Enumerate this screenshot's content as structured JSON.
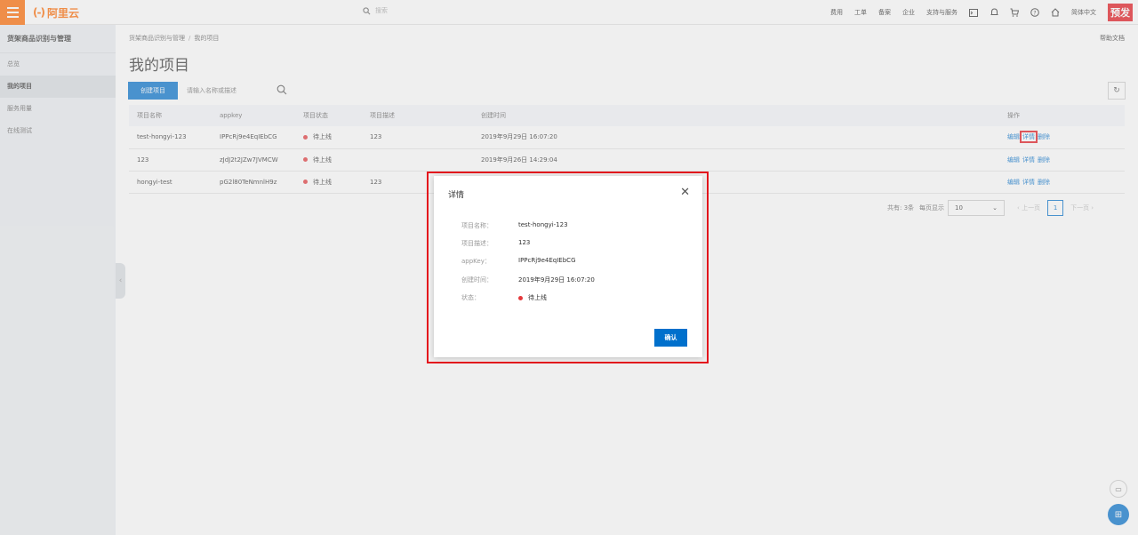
{
  "topbar": {
    "logo_text": "阿里云",
    "search_placeholder": "搜索",
    "links": [
      "费用",
      "工单",
      "备案",
      "企业",
      "支持与服务"
    ],
    "language": "简体中文",
    "preview_badge": "预发"
  },
  "sidebar": {
    "title": "货架商品识别与管理",
    "items": [
      {
        "label": "总览",
        "active": false
      },
      {
        "label": "我的项目",
        "active": true
      },
      {
        "label": "服务用量",
        "active": false
      },
      {
        "label": "在线测试",
        "active": false
      }
    ]
  },
  "main": {
    "breadcrumb_parent": "货架商品识别与管理",
    "breadcrumb_sep": "/",
    "breadcrumb_current": "我的项目",
    "help_doc": "帮助文档",
    "title": "我的项目",
    "create_button": "创建项目",
    "search_placeholder": "请输入名称或描述",
    "table": {
      "headers": [
        "项目名称",
        "appkey",
        "项目状态",
        "项目描述",
        "创建时间",
        "操作"
      ],
      "rows": [
        {
          "name": "test-hongyi-123",
          "appkey": "IPPcRj9e4EqIEbCG",
          "status": "待上线",
          "desc": "123",
          "created": "2019年9月29日 16:07:20"
        },
        {
          "name": "123",
          "appkey": "zJdJ2t2JZw7JVMCW",
          "status": "待上线",
          "desc": "",
          "created": "2019年9月26日 14:29:04"
        },
        {
          "name": "hongyi-test",
          "appkey": "pG2l80TeNmnlH9z",
          "status": "待上线",
          "desc": "123",
          "created": ""
        }
      ],
      "actions": {
        "edit": "编辑",
        "detail": "详情",
        "delete": "删除"
      }
    },
    "pagination": {
      "total": "共有: 3条",
      "per_page_label": "每页显示",
      "per_page": "10",
      "prev": "上一页",
      "page": "1",
      "next": "下一页"
    }
  },
  "dialog": {
    "title": "详情",
    "fields": [
      {
        "label": "项目名称：",
        "value": "test-hongyi-123"
      },
      {
        "label": "项目描述：",
        "value": "123"
      },
      {
        "label": "appKey：",
        "value": "IPPcRj9e4EqIEbCG"
      },
      {
        "label": "创建时间：",
        "value": "2019年9月29日 16:07:20"
      },
      {
        "label": "状态：",
        "value": "待上线"
      }
    ],
    "ok_button": "确认"
  },
  "colors": {
    "brand": "#ff6a00",
    "primary": "#0070cc",
    "highlight": "#e4141d",
    "status_dot": "#e4393c"
  }
}
